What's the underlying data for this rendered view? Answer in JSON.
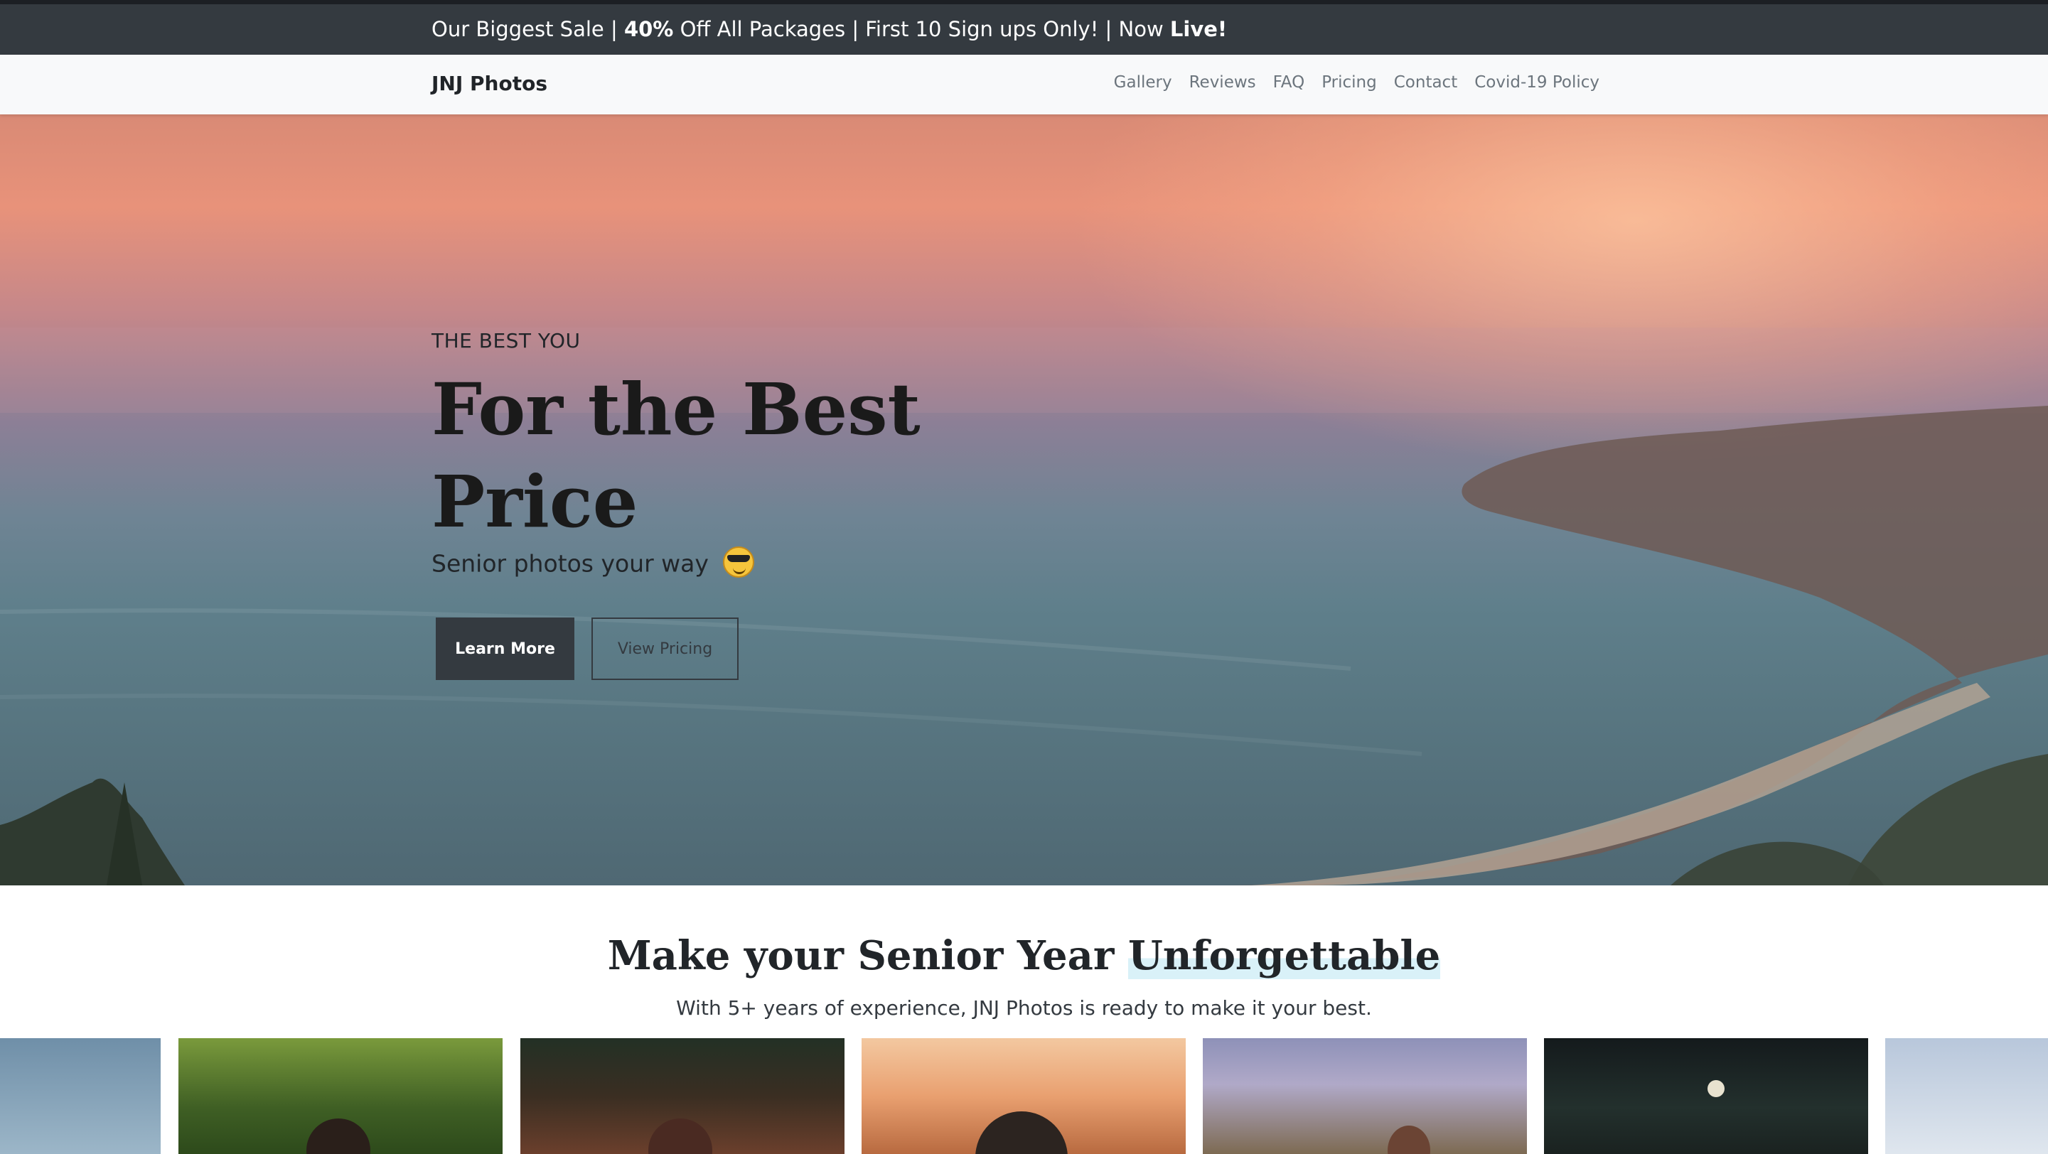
{
  "announcement": {
    "part1": "Our Biggest Sale |",
    "bold1": "40%",
    "part2": "Off All Packages | First 10 Sign ups Only! | Now",
    "bold2": "Live!"
  },
  "navbar": {
    "brand": "JNJ Photos",
    "links": [
      "Gallery",
      "Reviews",
      "FAQ",
      "Pricing",
      "Contact",
      "Covid-19 Policy"
    ]
  },
  "hero": {
    "eyebrow": "THE BEST YOU",
    "title": "For the Best Price",
    "subtitle": "Senior photos your way",
    "primary_button": "Learn More",
    "secondary_button": "View Pricing"
  },
  "intro": {
    "title_plain": "Make your Senior Year",
    "title_highlight": "Unforgettable",
    "subtitle": "With 5+ years of experience, JNJ Photos is ready to make it your best."
  },
  "icons": {
    "hero_emoji": "sunglasses-smiley-icon"
  },
  "colors": {
    "dark": "#343a40",
    "highlight": "#d9f1f8",
    "nav_text": "#6c757d"
  }
}
